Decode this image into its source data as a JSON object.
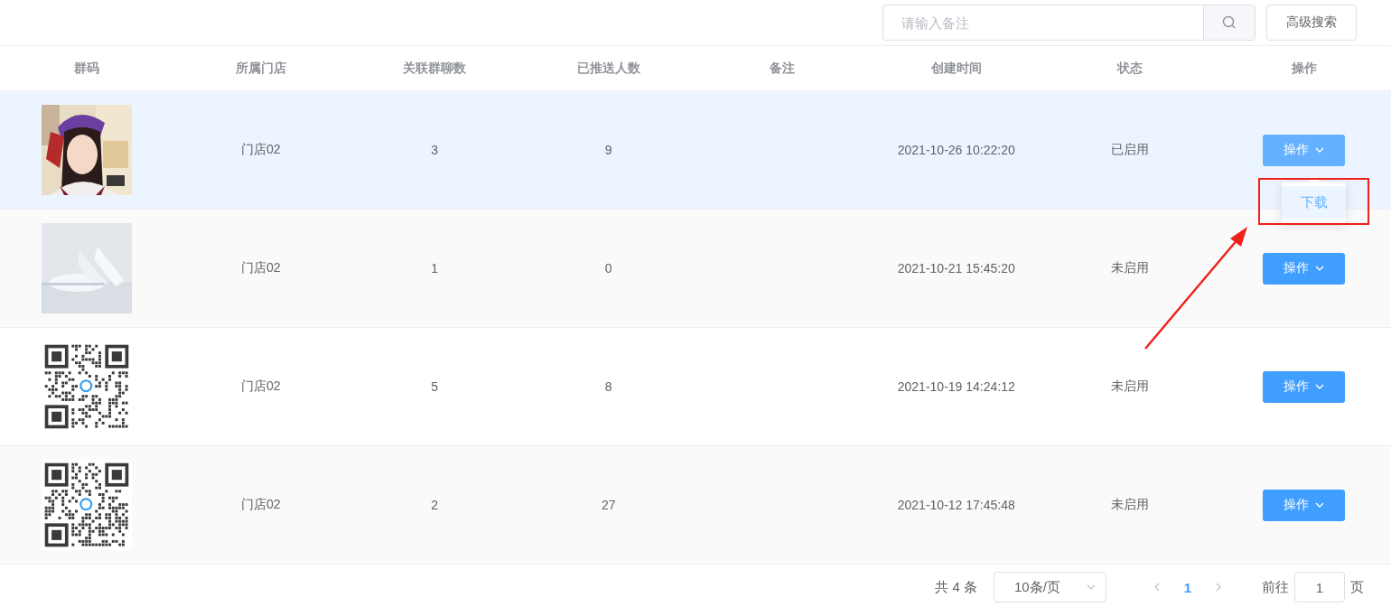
{
  "search": {
    "placeholder": "请输入备注",
    "advanced_button": "高级搜索"
  },
  "table": {
    "columns": [
      "群码",
      "所属门店",
      "关联群聊数",
      "已推送人数",
      "备注",
      "创建时间",
      "状态",
      "操作"
    ],
    "rows": [
      {
        "store": "门店02",
        "groups": "3",
        "pushed": "9",
        "created": "2021-10-26 10:22:20",
        "status": "已启用",
        "action": "操作",
        "hovered": true,
        "menu": [
          {
            "label": "下载",
            "selected": true
          }
        ]
      },
      {
        "image": {
          "kind": "pillows"
        },
        "store": "门店02",
        "groups": "1",
        "pushed": "0",
        "created": "2021-10-21 15:45:20",
        "status": "未启用",
        "action": "操作",
        "hovered": false
      },
      {
        "image": {
          "kind": "qr"
        },
        "store": "门店02",
        "groups": "5",
        "pushed": "8",
        "created": "2021-10-19 14:24:12",
        "status": "未启用",
        "action": "操作",
        "hovered": false
      },
      {
        "image": {
          "kind": "qr"
        },
        "store": "门店02",
        "groups": "2",
        "pushed": "27",
        "created": "2021-10-12 17:45:48",
        "status": "未启用",
        "action": "操作",
        "hovered": false
      }
    ]
  },
  "pagination": {
    "total": "共 4 条",
    "page_size": "10条/页",
    "pages": [
      {
        "label": "1",
        "selected": true
      }
    ],
    "goto_label": "前往",
    "goto_value": "1",
    "goto_suffix": "页"
  }
}
